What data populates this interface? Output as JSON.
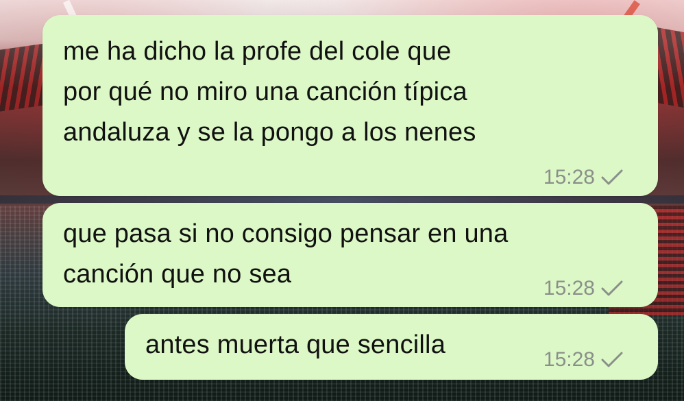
{
  "colors": {
    "bubble": "#dcf8c6",
    "text": "#111111",
    "meta": "#8a8f8a"
  },
  "messages": [
    {
      "text": "me ha dicho la profe del cole que\npor qué no miro una canción típica\nandaluza y se la pongo a los nenes",
      "time": "15:28",
      "status_icon": "single-check-icon"
    },
    {
      "text": "que pasa si no consigo pensar en una\ncanción que no sea",
      "time": "15:28",
      "status_icon": "single-check-icon"
    },
    {
      "text": "antes muerta que sencilla",
      "time": "15:28",
      "status_icon": "single-check-icon"
    }
  ]
}
